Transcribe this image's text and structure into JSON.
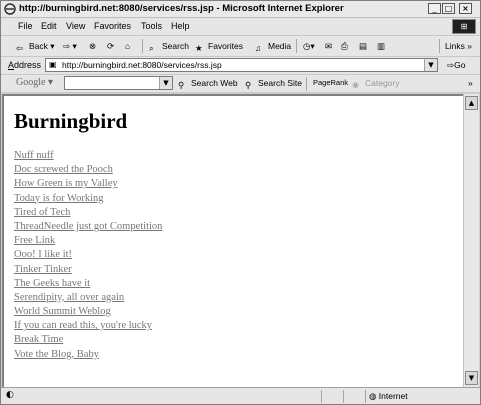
{
  "window": {
    "title": "http://burningbird.net:8080/services/rss.jsp - Microsoft Internet Explorer",
    "buttons": {
      "minimize": "_",
      "maximize": "□",
      "close": "×"
    }
  },
  "menu": {
    "items": [
      "File",
      "Edit",
      "View",
      "Favorites",
      "Tools",
      "Help"
    ]
  },
  "toolbar": {
    "back": "Back",
    "search": "Search",
    "favorites": "Favorites",
    "media": "Media",
    "links": "Links",
    "overflow": "»"
  },
  "address": {
    "label": "Address",
    "url": "http://burningbird.net:8080/services/rss.jsp",
    "go": "Go"
  },
  "google": {
    "logo": "Google",
    "search_web": "Search Web",
    "search_site": "Search Site",
    "pagerank": "PageRank",
    "category": "Category",
    "overflow": "»"
  },
  "page": {
    "heading": "Burningbird",
    "links": [
      "Nuff nuff",
      "Doc screwed the Pooch",
      "How Green is my Valley",
      "Today is for Working",
      "Tired of Tech",
      "ThreadNeedle just got Competition",
      "Free Link",
      "Ooo! I like it!",
      "Tinker Tinker",
      "The Geeks have it",
      "Serendipity, all over again",
      "World Summit Weblog",
      "If you can read this, you're lucky",
      "Break Time",
      "Vote the Blog, Baby"
    ]
  },
  "status": {
    "zone": "Internet"
  },
  "colors": {
    "link": "#777777",
    "chrome": "#e6e6e6"
  }
}
